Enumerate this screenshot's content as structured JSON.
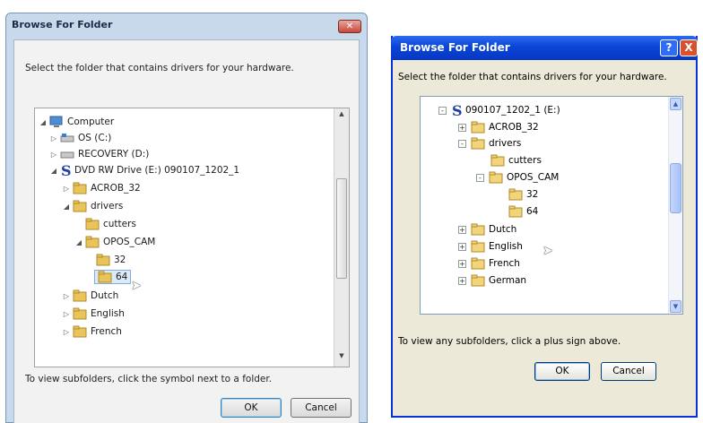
{
  "win7": {
    "title": "Browse For Folder",
    "close_icon": "close-icon",
    "prompt": "Select the folder that contains drivers for your hardware.",
    "tree": [
      {
        "label": "Computer",
        "icon": "computer-icon",
        "expanded": true
      },
      {
        "label": "OS (C:)",
        "icon": "drive-icon",
        "expanded": false
      },
      {
        "label": "RECOVERY (D:)",
        "icon": "drive-icon",
        "expanded": false
      },
      {
        "label": "DVD RW Drive (E:) 090107_1202_1",
        "icon": "dvd-icon",
        "expanded": true
      },
      {
        "label": "ACROB_32",
        "icon": "folder-icon",
        "expanded": false
      },
      {
        "label": "drivers",
        "icon": "folder-icon",
        "expanded": true
      },
      {
        "label": "cutters",
        "icon": "folder-icon"
      },
      {
        "label": "OPOS_CAM",
        "icon": "folder-icon",
        "expanded": true
      },
      {
        "label": "32",
        "icon": "folder-icon"
      },
      {
        "label": "64",
        "icon": "folder-icon",
        "selected": true
      },
      {
        "label": "Dutch",
        "icon": "folder-icon",
        "expanded": false
      },
      {
        "label": "English",
        "icon": "folder-icon",
        "expanded": false
      },
      {
        "label": "French",
        "icon": "folder-icon",
        "expanded": false
      }
    ],
    "hint": "To view subfolders, click the symbol next to a folder.",
    "ok_label": "OK",
    "cancel_label": "Cancel"
  },
  "xp": {
    "title": "Browse For Folder",
    "help_label": "?",
    "close_label": "X",
    "prompt": "Select the folder that contains drivers for your hardware.",
    "tree": [
      {
        "label": "090107_1202_1 (E:)",
        "icon": "dvd-icon",
        "toggle": "-"
      },
      {
        "label": "ACROB_32",
        "icon": "folder-icon",
        "toggle": "+"
      },
      {
        "label": "drivers",
        "icon": "folder-icon",
        "toggle": "-"
      },
      {
        "label": "cutters",
        "icon": "folder-icon",
        "toggle": ""
      },
      {
        "label": "OPOS_CAM",
        "icon": "folder-icon",
        "toggle": "-"
      },
      {
        "label": "32",
        "icon": "folder-icon",
        "toggle": ""
      },
      {
        "label": "64",
        "icon": "folder-icon",
        "toggle": ""
      },
      {
        "label": "Dutch",
        "icon": "folder-icon",
        "toggle": "+"
      },
      {
        "label": "English",
        "icon": "folder-icon",
        "toggle": "+"
      },
      {
        "label": "French",
        "icon": "folder-icon",
        "toggle": "+"
      },
      {
        "label": "German",
        "icon": "folder-icon",
        "toggle": "+"
      }
    ],
    "hint": "To view any subfolders, click a plus sign above.",
    "ok_label": "OK",
    "cancel_label": "Cancel"
  },
  "colors": {
    "win7_frame": "#c9d9ec",
    "xp_titlebar": "#0a45d6",
    "folder": "#e8c45a",
    "selection": "#dce9f7"
  }
}
